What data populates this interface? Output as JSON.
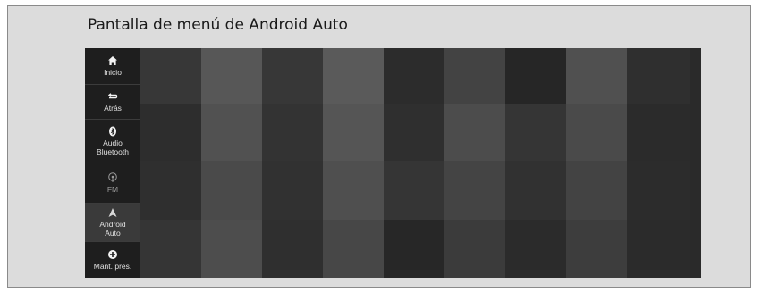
{
  "page": {
    "title": "Pantalla de menú de Android Auto"
  },
  "sidebar": {
    "items": [
      {
        "id": "inicio",
        "label": "Inicio",
        "icon": "home-icon",
        "active": false
      },
      {
        "id": "atras",
        "label": "Atrás",
        "icon": "back-icon",
        "active": false
      },
      {
        "id": "audio-bluetooth",
        "label": "Audio Bluetooth",
        "label_line1": "Audio",
        "label_line2": "Bluetooth",
        "icon": "bluetooth-icon",
        "active": false
      },
      {
        "id": "fm",
        "label": "FM",
        "icon": "radio-icon",
        "active": false
      },
      {
        "id": "android-auto",
        "label": "Android Auto",
        "label_line1": "Android",
        "label_line2": "Auto",
        "icon": "navigation-arrow-icon",
        "active": true
      },
      {
        "id": "mant-pres",
        "label": "Mant. pres.",
        "icon": "plus-circle-icon",
        "active": false
      }
    ]
  },
  "colors": {
    "frame_background": "#dcdcdc",
    "sidebar_background": "#1e1e1e",
    "active_item_background": "#3a3a3a",
    "tile_shades": [
      [
        "#373737",
        "#575757",
        "#373737",
        "#5a5a5a",
        "#2c2c2c",
        "#434343",
        "#262626",
        "#505050",
        "#2f2f2f"
      ],
      [
        "#2d2d2d",
        "#515151",
        "#333333",
        "#555555",
        "#2f2f2f",
        "#4c4c4c",
        "#353535",
        "#4a4a4a",
        "#2b2b2b"
      ],
      [
        "#2f2f2f",
        "#4a4a4a",
        "#313131",
        "#4f4f4f",
        "#353535",
        "#444444",
        "#313131",
        "#434343",
        "#2c2c2c"
      ],
      [
        "#353535",
        "#4d4d4d",
        "#2f2f2f",
        "#474747",
        "#272727",
        "#3b3b3b",
        "#2b2b2b",
        "#3d3d3d",
        "#2b2b2b"
      ]
    ]
  }
}
